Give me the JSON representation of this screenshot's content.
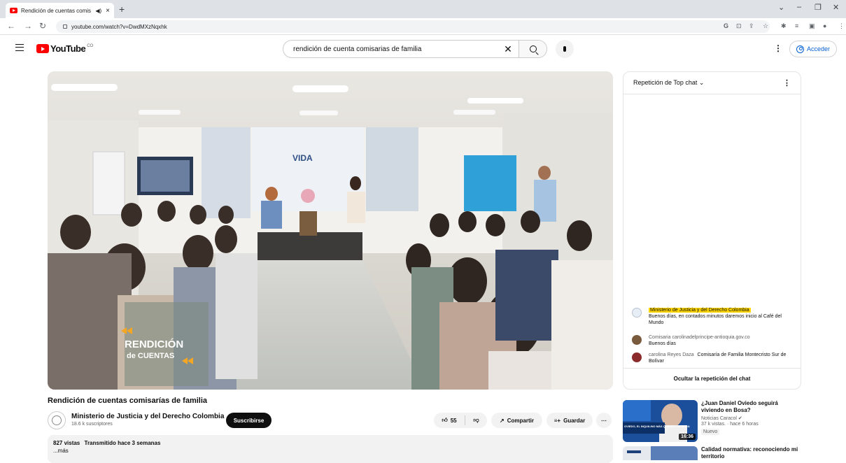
{
  "browser": {
    "tab_title": "Rendición de cuentas comis",
    "url": "youtube.com/watch?v=DwdMXzNqxhk",
    "icons": [
      "back-icon",
      "forward-icon",
      "reload-icon",
      "lock-icon",
      "google-icon",
      "extension-icon",
      "share-icon",
      "star-icon",
      "puzzle-icon",
      "tab-search-icon",
      "sidepanel-icon",
      "profile-icon",
      "menu-icon"
    ]
  },
  "header": {
    "logo_text": "YouTube",
    "logo_superscript": "CO",
    "search_query": "rendición de cuenta comisarias de familia",
    "signin_label": "Acceder"
  },
  "video": {
    "overlay_line1": "RENDICIÓN",
    "overlay_line2": "de CUENTAS",
    "banner_text": "VIDA",
    "title": "Rendición de cuentas comisarías de familia",
    "channel_name": "Ministerio de Justicia y del Derecho Colombia",
    "subscribers": "18.6 k suscriptores",
    "subscribe_label": "Suscribirse",
    "likes": "55",
    "share_label": "Compartir",
    "save_label": "Guardar",
    "views": "827 vistas",
    "streamed": "Transmitido hace 3 semanas",
    "more_label": "...más"
  },
  "chat": {
    "header": "Repetición de Top chat",
    "messages": [
      {
        "author": "Ministerio de Justicia y del Derecho Colombia",
        "text": "Buenos días, en contados minutos daremos inicio al Café del Mundo",
        "highlight": true,
        "avatar_color": "#e8eef5"
      },
      {
        "author": "Comisaria carolinadelprincipe-antioquia.gov.co",
        "text": "Buenos días",
        "highlight": false,
        "avatar_color": "#7a5a3c"
      },
      {
        "author": "carolina Reyes Daza",
        "text": "Comisaría de Familia Montecristo Sur de Bolívar",
        "highlight": false,
        "avatar_color": "#8b2b2b"
      }
    ],
    "hide_label": "Ocultar la repetición del chat"
  },
  "recommendations": [
    {
      "title": "¿Juan Daniel Oviedo seguirá viviendo en Bosa?",
      "channel": "Noticias Caracol",
      "meta": "37 k vistas. · hace 6 horas",
      "badge": "Nuevo",
      "duration": "16:36",
      "thumb_caption": "OVIEDO, EL INQUILINO MÁS QUERIDO DE BOSA"
    },
    {
      "title": "Calidad normativa: reconociendo mi territorio",
      "channel": "",
      "meta": "",
      "badge": "",
      "duration": "",
      "thumb_caption": ""
    }
  ],
  "colors": {
    "brand_red": "#ff0000",
    "link_blue": "#065fd4",
    "highlight_yellow": "#ffd600",
    "overlay_orange": "#f5a623"
  }
}
